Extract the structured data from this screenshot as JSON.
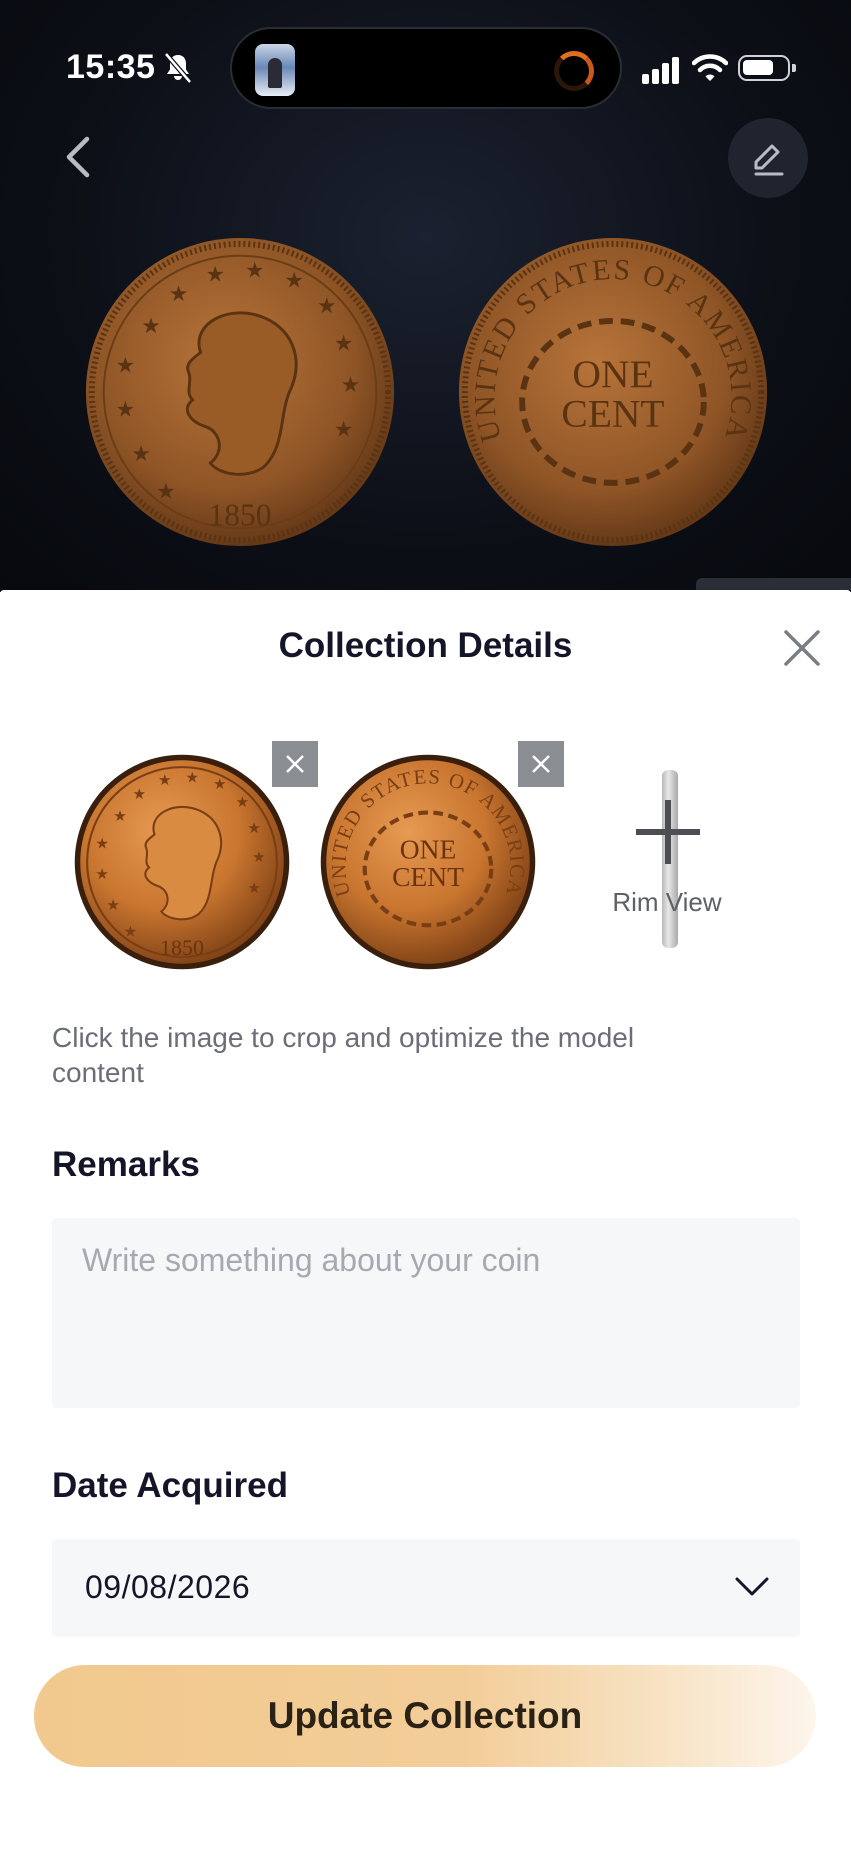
{
  "status_bar": {
    "time": "15:35"
  },
  "coins": {
    "obverse_year": "1850",
    "reverse_text_line1": "ONE",
    "reverse_text_line2": "CENT",
    "reverse_legend": "UNITED STATES OF AMERICA"
  },
  "sheet": {
    "title": "Collection Details",
    "rim_view_label": "Rim View",
    "hint": "Click the image to crop and optimize the model content",
    "remarks_label": "Remarks",
    "remarks_placeholder": "Write something about your coin",
    "remarks_value": "",
    "date_label": "Date Acquired",
    "date_value": "09/08/2026",
    "submit_label": "Update Collection"
  },
  "colors": {
    "copper": "#c9782f",
    "accent_gold": "#f1c98e",
    "hero_bg": "#0c0f16"
  },
  "icons": [
    "bell-slash-icon",
    "back-chevron-icon",
    "edit-pencil-icon",
    "close-icon",
    "remove-x-icon",
    "plus-icon",
    "chevron-down-icon",
    "wifi-icon",
    "signal-icon",
    "battery-icon"
  ]
}
